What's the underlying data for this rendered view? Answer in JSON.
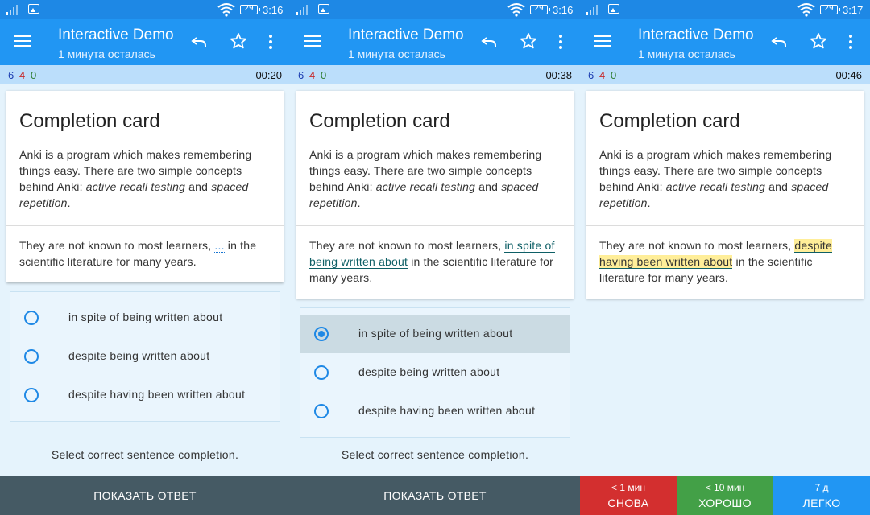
{
  "colors": {
    "status_bar": "#1e88e5",
    "app_bar": "#2196f3",
    "counts_bar": "#bbdefb",
    "again": "#d32f2f",
    "good": "#43a047",
    "easy": "#2196f3",
    "show_answer": "#455a64"
  },
  "screens": [
    {
      "status": {
        "battery": "29",
        "time": "3:16"
      },
      "toolbar": {
        "title": "Interactive Demo",
        "subtitle": "1 минута осталась"
      },
      "counts": {
        "new": "6",
        "learn": "4",
        "review": "0",
        "timer": "00:20"
      },
      "card": {
        "title": "Completion card",
        "desc_1": "Anki is a program which makes remembering things easy. There are two simple concepts behind Anki: ",
        "desc_em1": "active recall testing",
        "desc_2": " and ",
        "desc_em2": "spaced repetition",
        "desc_3": ".",
        "cloze_pre": "They are not known to most learners,",
        "cloze_blank": "...",
        "cloze_post": "in the scientific literature for many years."
      },
      "options": [
        "in spite of being written about",
        "despite being written about",
        "despite having been written about"
      ],
      "hint": "Select correct sentence completion.",
      "show_answer": "ПОКАЗАТЬ ОТВЕТ"
    },
    {
      "status": {
        "battery": "29",
        "time": "3:16"
      },
      "toolbar": {
        "title": "Interactive Demo",
        "subtitle": "1 минута осталась"
      },
      "counts": {
        "new": "6",
        "learn": "4",
        "review": "0",
        "timer": "00:38"
      },
      "card": {
        "title": "Completion card",
        "desc_1": "Anki is a program which makes remembering things easy. There are two simple concepts behind Anki: ",
        "desc_em1": "active recall testing",
        "desc_2": " and ",
        "desc_em2": "spaced repetition",
        "desc_3": ".",
        "cloze_pre": "They are not known to most learners,",
        "cloze_fill": "in spite of being written about",
        "cloze_post": "in the scientific literature for many years."
      },
      "options": [
        "in spite of being written about",
        "despite being written about",
        "despite having been written about"
      ],
      "selected_option": "in spite of being written about",
      "hint": "Select correct sentence completion.",
      "show_answer": "ПОКАЗАТЬ ОТВЕТ"
    },
    {
      "status": {
        "battery": "29",
        "time": "3:17"
      },
      "toolbar": {
        "title": "Interactive Demo",
        "subtitle": "1 минута осталась"
      },
      "counts": {
        "new": "6",
        "learn": "4",
        "review": "0",
        "timer": "00:46"
      },
      "card": {
        "title": "Completion card",
        "desc_1": "Anki is a program which makes remembering things easy. There are two simple concepts behind Anki: ",
        "desc_em1": "active recall testing",
        "desc_2": " and ",
        "desc_em2": "spaced repetition",
        "desc_3": ".",
        "cloze_pre": "They are not known to most learners,",
        "cloze_answer": "despite having been written about",
        "cloze_post": "in the scientific literature for many years."
      },
      "answer_buttons": [
        {
          "interval": "< 1 мин",
          "label": "СНОВА"
        },
        {
          "interval": "< 10 мин",
          "label": "ХОРОШО"
        },
        {
          "interval": "7 д",
          "label": "ЛЕГКО"
        }
      ]
    }
  ]
}
